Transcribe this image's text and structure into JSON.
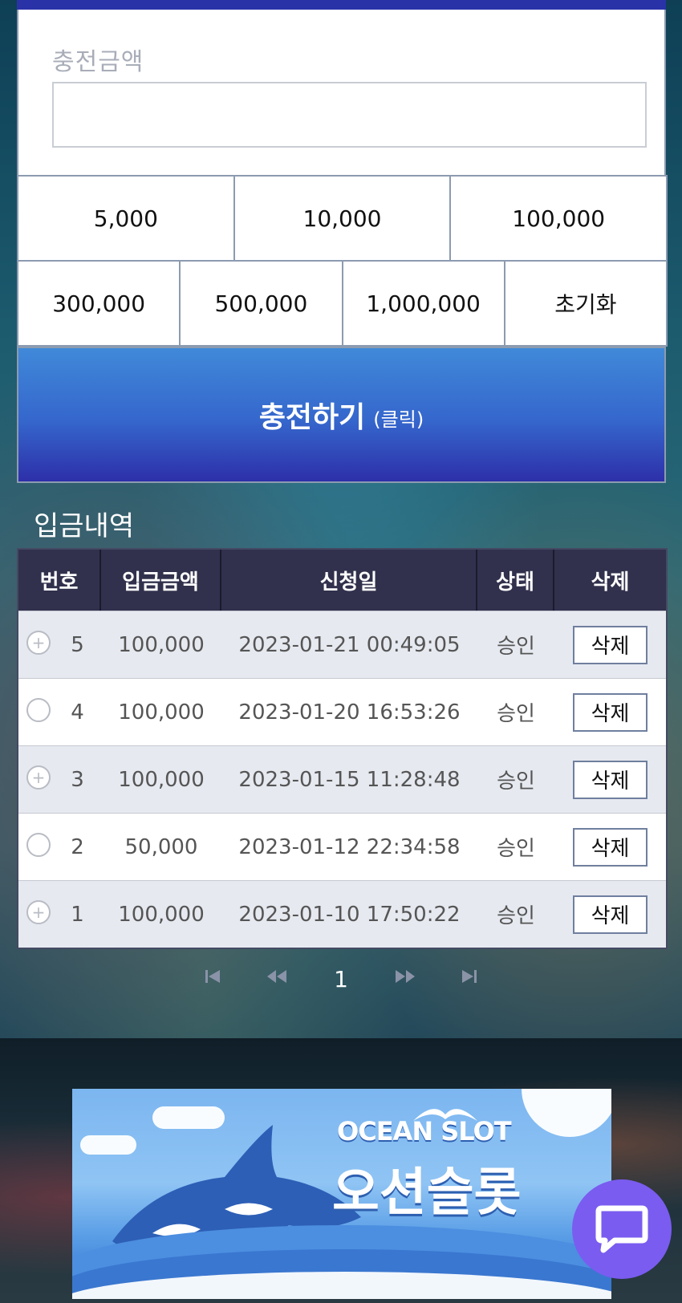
{
  "charge": {
    "amount_label": "충전금액",
    "amount_value": "",
    "quick_amounts_row1": [
      "5,000",
      "10,000",
      "100,000"
    ],
    "quick_amounts_row2": [
      "300,000",
      "500,000",
      "1,000,000"
    ],
    "reset_label": "초기화",
    "submit_label": "충전하기",
    "submit_hint": "(클릭)"
  },
  "history": {
    "title": "입금내역",
    "columns": [
      "번호",
      "입금금액",
      "신청일",
      "상태",
      "삭제"
    ],
    "rows": [
      {
        "no": "5",
        "amount": "100,000",
        "date": "2023-01-21 00:49:05",
        "status": "승인",
        "delete_label": "삭제"
      },
      {
        "no": "4",
        "amount": "100,000",
        "date": "2023-01-20 16:53:26",
        "status": "승인",
        "delete_label": "삭제"
      },
      {
        "no": "3",
        "amount": "100,000",
        "date": "2023-01-15 11:28:48",
        "status": "승인",
        "delete_label": "삭제"
      },
      {
        "no": "2",
        "amount": "50,000",
        "date": "2023-01-12 22:34:58",
        "status": "승인",
        "delete_label": "삭제"
      },
      {
        "no": "1",
        "amount": "100,000",
        "date": "2023-01-10 17:50:22",
        "status": "승인",
        "delete_label": "삭제"
      }
    ]
  },
  "pagination": {
    "current_page": "1",
    "first_icon": "first-page-icon",
    "prev_icon": "prev-page-icon",
    "next_icon": "next-page-icon",
    "last_icon": "last-page-icon"
  },
  "banner": {
    "title_en": "OCEAN SLOT",
    "title_ko": "오션슬롯"
  },
  "chat": {
    "icon": "chat-bubble-icon",
    "color": "#7a5cf0"
  },
  "colors": {
    "primary": "#2a32a8",
    "button_gradient_top": "#4089d9",
    "table_header": "#31314d"
  }
}
